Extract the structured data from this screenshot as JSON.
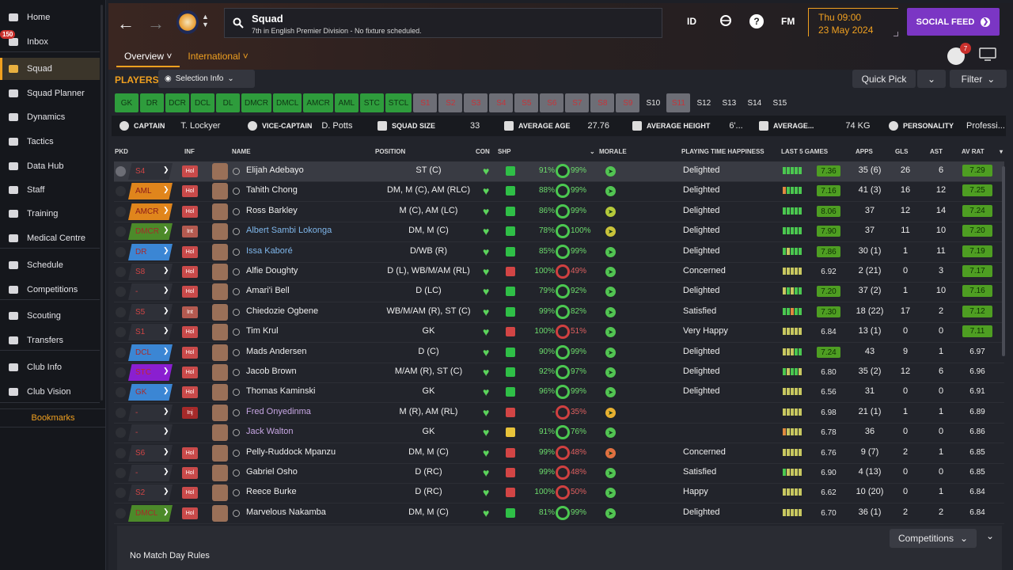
{
  "sidebar": {
    "inbox_badge": "150",
    "items": [
      {
        "label": "Home",
        "icon": "home-icon"
      },
      {
        "label": "Inbox",
        "icon": "inbox-icon"
      },
      {
        "label": "Squad",
        "icon": "squad-icon"
      },
      {
        "label": "Squad Planner",
        "icon": "planner-icon"
      },
      {
        "label": "Dynamics",
        "icon": "dynamics-icon"
      },
      {
        "label": "Tactics",
        "icon": "tactics-icon"
      },
      {
        "label": "Data Hub",
        "icon": "data-hub-icon"
      },
      {
        "label": "Staff",
        "icon": "staff-icon"
      },
      {
        "label": "Training",
        "icon": "training-icon"
      },
      {
        "label": "Medical Centre",
        "icon": "medical-icon"
      },
      {
        "label": "Schedule",
        "icon": "schedule-icon"
      },
      {
        "label": "Competitions",
        "icon": "trophy-icon"
      },
      {
        "label": "Scouting",
        "icon": "scouting-icon"
      },
      {
        "label": "Transfers",
        "icon": "transfers-icon"
      },
      {
        "label": "Club Info",
        "icon": "shield-icon"
      },
      {
        "label": "Club Vision",
        "icon": "vision-icon"
      }
    ],
    "bookmarks": "Bookmarks"
  },
  "header": {
    "title": "Squad",
    "subtitle": "7th in English Premier Division - No fixture scheduled.",
    "id_label": "ID",
    "fm_label": "FM",
    "help_label": "?",
    "day_time": "Thu 09:00",
    "date": "23 May 2024",
    "social_feed": "SOCIAL FEED",
    "people_badge": "7",
    "tabs": [
      {
        "label": "Overview ˅"
      },
      {
        "label": "International ˅"
      }
    ]
  },
  "toolbar": {
    "players_label": "PLAYERS",
    "selection_info": "Selection Info",
    "quick_pick": "Quick Pick",
    "filter": "Filter"
  },
  "positions": [
    {
      "label": "GK",
      "style": "green"
    },
    {
      "label": "DR",
      "style": "green"
    },
    {
      "label": "DCR",
      "style": "green"
    },
    {
      "label": "DCL",
      "style": "green"
    },
    {
      "label": "DL",
      "style": "green"
    },
    {
      "label": "DMCR",
      "style": "green"
    },
    {
      "label": "DMCL",
      "style": "green"
    },
    {
      "label": "AMCR",
      "style": "green"
    },
    {
      "label": "AML",
      "style": "green"
    },
    {
      "label": "STC",
      "style": "green"
    },
    {
      "label": "STCL",
      "style": "green"
    },
    {
      "label": "S1",
      "style": "grey"
    },
    {
      "label": "S2",
      "style": "grey"
    },
    {
      "label": "S3",
      "style": "grey"
    },
    {
      "label": "S4",
      "style": "grey"
    },
    {
      "label": "S5",
      "style": "grey"
    },
    {
      "label": "S6",
      "style": "grey"
    },
    {
      "label": "S7",
      "style": "grey"
    },
    {
      "label": "S8",
      "style": "grey"
    },
    {
      "label": "S9",
      "style": "grey"
    },
    {
      "label": "S10",
      "style": "plain"
    },
    {
      "label": "S11",
      "style": "grey"
    },
    {
      "label": "S12",
      "style": "plain"
    },
    {
      "label": "S13",
      "style": "plain"
    },
    {
      "label": "S14",
      "style": "plain"
    },
    {
      "label": "S15",
      "style": "plain"
    }
  ],
  "info_bar": {
    "captain_label": "CAPTAIN",
    "captain": "T. Lockyer",
    "vice_label": "VICE-CAPTAIN",
    "vice": "D. Potts",
    "size_label": "SQUAD SIZE",
    "size": "33",
    "age_label": "AVERAGE AGE",
    "age": "27.76",
    "height_label": "AVERAGE HEIGHT",
    "height": "6'...",
    "weight_label": "AVERAGE...",
    "weight": "74 KG",
    "personality_label": "PERSONALITY",
    "personality": "Professi..."
  },
  "columns": {
    "pkd": "PKD",
    "inf": "INF",
    "name": "NAME",
    "position": "POSITION",
    "con": "CON",
    "shp": "SHP",
    "morale": "MORALE",
    "pth": "PLAYING TIME HAPPINESS",
    "last5": "LAST 5 GAMES",
    "apps": "APPS",
    "gls": "GLS",
    "ast": "AST",
    "avrat": "AV RAT"
  },
  "players": [
    {
      "pos": "S4",
      "posColor": "#2e3038",
      "posText": "#d04545",
      "inf": "Hol",
      "name": "Elijah Adebayo",
      "nameStyle": "",
      "position": "ST (C)",
      "shp": "#2fbf47",
      "cond": "91%",
      "ringColor": "#4bc850",
      "morale": "99%",
      "moraleColor": "#6ddc6d",
      "moraleIcon": "#52c452",
      "pth": "Delighted",
      "bars": [
        "g",
        "g",
        "g",
        "g",
        "g"
      ],
      "last": "7.36",
      "lastHi": true,
      "apps": "35 (6)",
      "gls": "26",
      "ast": "6",
      "av": "7.29",
      "avHi": true,
      "pkd": true
    },
    {
      "pos": "AML",
      "posColor": "#e0851c",
      "posText": "#8a1a1a",
      "inf": "Hol",
      "name": "Tahith Chong",
      "nameStyle": "",
      "position": "DM, M (C), AM (RLC)",
      "shp": "#2fbf47",
      "cond": "88%",
      "ringColor": "#4bc850",
      "morale": "99%",
      "moraleColor": "#6ddc6d",
      "moraleIcon": "#52c452",
      "pth": "Delighted",
      "bars": [
        "o",
        "g",
        "g",
        "g",
        "g"
      ],
      "last": "7.16",
      "lastHi": true,
      "apps": "41 (3)",
      "gls": "16",
      "ast": "12",
      "av": "7.25",
      "avHi": true
    },
    {
      "pos": "AMCR",
      "posColor": "#e0851c",
      "posText": "#8a1a1a",
      "inf": "Hol",
      "name": "Ross Barkley",
      "nameStyle": "",
      "position": "M (C), AM (LC)",
      "shp": "#2fbf47",
      "cond": "86%",
      "ringColor": "#4bc850",
      "morale": "99%",
      "moraleColor": "#6ddc6d",
      "moraleIcon": "#b5c93a",
      "pth": "Delighted",
      "bars": [
        "g",
        "g",
        "g",
        "g",
        "g"
      ],
      "last": "8.06",
      "lastHi": true,
      "apps": "37",
      "gls": "12",
      "ast": "14",
      "av": "7.24",
      "avHi": true
    },
    {
      "pos": "DMCR",
      "posColor": "#4c8a2a",
      "posText": "#a82a2a",
      "inf": "Int",
      "name": "Albert Sambi Lokonga",
      "nameStyle": "blue",
      "position": "DM, M (C)",
      "shp": "#2fbf47",
      "cond": "78%",
      "ringColor": "#4bc850",
      "morale": "100%",
      "moraleColor": "#6ddc6d",
      "moraleIcon": "#c9c33a",
      "pth": "Delighted",
      "bars": [
        "g",
        "g",
        "g",
        "g",
        "g"
      ],
      "last": "7.90",
      "lastHi": true,
      "apps": "37",
      "gls": "11",
      "ast": "10",
      "av": "7.20",
      "avHi": true
    },
    {
      "pos": "DR",
      "posColor": "#3b86d4",
      "posText": "#a82a2a",
      "inf": "Hol",
      "name": "Issa Kaboré",
      "nameStyle": "blue",
      "position": "D/WB (R)",
      "shp": "#2fbf47",
      "cond": "85%",
      "ringColor": "#4bc850",
      "morale": "99%",
      "moraleColor": "#6ddc6d",
      "moraleIcon": "#52c452",
      "pth": "Delighted",
      "bars": [
        "g",
        "y",
        "g",
        "g",
        "g"
      ],
      "last": "7.86",
      "lastHi": true,
      "apps": "30 (1)",
      "gls": "1",
      "ast": "11",
      "av": "7.19",
      "avHi": true
    },
    {
      "pos": "S8",
      "posColor": "#2e3038",
      "posText": "#d04545",
      "inf": "Hol",
      "name": "Alfie Doughty",
      "nameStyle": "",
      "position": "D (L), WB/M/AM (RL)",
      "shp": "#d24545",
      "cond": "100%",
      "ringColor": "#d04040",
      "morale": "49%",
      "moraleColor": "#e06060",
      "moraleIcon": "#52c452",
      "pth": "Concerned",
      "bars": [
        "y",
        "y",
        "y",
        "y",
        "y"
      ],
      "last": "6.92",
      "lastHi": false,
      "apps": "2 (21)",
      "gls": "0",
      "ast": "3",
      "av": "7.17",
      "avHi": true
    },
    {
      "pos": "-",
      "posColor": "#2e3038",
      "posText": "#d04545",
      "inf": "Hol",
      "name": "Amari'i Bell",
      "nameStyle": "",
      "position": "D (LC)",
      "shp": "#2fbf47",
      "cond": "79%",
      "ringColor": "#4bc850",
      "morale": "92%",
      "moraleColor": "#6ddc6d",
      "moraleIcon": "#52c452",
      "pth": "Delighted",
      "bars": [
        "y",
        "g",
        "y",
        "g",
        "g"
      ],
      "last": "7.20",
      "lastHi": true,
      "apps": "37 (2)",
      "gls": "1",
      "ast": "10",
      "av": "7.16",
      "avHi": true
    },
    {
      "pos": "S5",
      "posColor": "#2e3038",
      "posText": "#d04545",
      "inf": "Int",
      "name": "Chiedozie Ogbene",
      "nameStyle": "",
      "position": "WB/M/AM (R), ST (C)",
      "shp": "#2fbf47",
      "cond": "99%",
      "ringColor": "#4bc850",
      "morale": "82%",
      "moraleColor": "#6ddc6d",
      "moraleIcon": "#52c452",
      "pth": "Satisfied",
      "bars": [
        "g",
        "g",
        "o",
        "g",
        "g"
      ],
      "last": "7.30",
      "lastHi": true,
      "apps": "18 (22)",
      "gls": "17",
      "ast": "2",
      "av": "7.12",
      "avHi": true
    },
    {
      "pos": "S1",
      "posColor": "#2e3038",
      "posText": "#d04545",
      "inf": "Hol",
      "name": "Tim Krul",
      "nameStyle": "",
      "position": "GK",
      "shp": "#d24545",
      "cond": "100%",
      "ringColor": "#d04040",
      "morale": "51%",
      "moraleColor": "#e06060",
      "moraleIcon": "#52c452",
      "pth": "Very Happy",
      "bars": [
        "y",
        "y",
        "y",
        "y",
        "y"
      ],
      "last": "6.84",
      "lastHi": false,
      "apps": "13 (1)",
      "gls": "0",
      "ast": "0",
      "av": "7.11",
      "avHi": true
    },
    {
      "pos": "DCL",
      "posColor": "#3b86d4",
      "posText": "#a82a2a",
      "inf": "Hol",
      "name": "Mads Andersen",
      "nameStyle": "",
      "position": "D (C)",
      "shp": "#2fbf47",
      "cond": "90%",
      "ringColor": "#4bc850",
      "morale": "99%",
      "moraleColor": "#6ddc6d",
      "moraleIcon": "#52c452",
      "pth": "Delighted",
      "bars": [
        "y",
        "y",
        "y",
        "g",
        "g"
      ],
      "last": "7.24",
      "lastHi": true,
      "apps": "43",
      "gls": "9",
      "ast": "1",
      "av": "6.97",
      "avHi": false
    },
    {
      "pos": "STC",
      "posColor": "#8a1fd0",
      "posText": "#c02a2a",
      "inf": "Hol",
      "name": "Jacob Brown",
      "nameStyle": "",
      "position": "M/AM (R), ST (C)",
      "shp": "#2fbf47",
      "cond": "92%",
      "ringColor": "#4bc850",
      "morale": "97%",
      "moraleColor": "#6ddc6d",
      "moraleIcon": "#52c452",
      "pth": "Delighted",
      "bars": [
        "g",
        "y",
        "g",
        "g",
        "y"
      ],
      "last": "6.80",
      "lastHi": false,
      "apps": "35 (2)",
      "gls": "12",
      "ast": "6",
      "av": "6.96",
      "avHi": false
    },
    {
      "pos": "GK",
      "posColor": "#3b86d4",
      "posText": "#a82a2a",
      "inf": "Hol",
      "name": "Thomas Kaminski",
      "nameStyle": "",
      "position": "GK",
      "shp": "#2fbf47",
      "cond": "96%",
      "ringColor": "#4bc850",
      "morale": "99%",
      "moraleColor": "#6ddc6d",
      "moraleIcon": "#52c452",
      "pth": "Delighted",
      "bars": [
        "y",
        "y",
        "y",
        "y",
        "y"
      ],
      "last": "6.56",
      "lastHi": false,
      "apps": "31",
      "gls": "0",
      "ast": "0",
      "av": "6.91",
      "avHi": false
    },
    {
      "pos": "-",
      "posColor": "#2e3038",
      "posText": "#d04545",
      "inf": "Inj",
      "name": "Fred Onyedinma",
      "nameStyle": "purple",
      "position": "M (R), AM (RL)",
      "shp": "#d24545",
      "cond": "-",
      "ringColor": "#d04040",
      "morale": "35%",
      "moraleColor": "#e06060",
      "moraleIcon": "#e8b030",
      "pth": "",
      "bars": [
        "y",
        "y",
        "y",
        "y",
        "y"
      ],
      "last": "6.98",
      "lastHi": false,
      "apps": "21 (1)",
      "gls": "1",
      "ast": "1",
      "av": "6.89",
      "avHi": false
    },
    {
      "pos": "-",
      "posColor": "#2e3038",
      "posText": "#d04545",
      "inf": "",
      "name": "Jack Walton",
      "nameStyle": "purple",
      "position": "GK",
      "shp": "#e8c33a",
      "cond": "91%",
      "ringColor": "#4bc850",
      "morale": "76%",
      "moraleColor": "#6ddc6d",
      "moraleIcon": "#52c452",
      "pth": "",
      "bars": [
        "o",
        "y",
        "y",
        "y",
        "y"
      ],
      "last": "6.78",
      "lastHi": false,
      "apps": "36",
      "gls": "0",
      "ast": "0",
      "av": "6.86",
      "avHi": false
    },
    {
      "pos": "S6",
      "posColor": "#2e3038",
      "posText": "#d04545",
      "inf": "Hol",
      "name": "Pelly-Ruddock Mpanzu",
      "nameStyle": "",
      "position": "DM, M (C)",
      "shp": "#d24545",
      "cond": "99%",
      "ringColor": "#d04040",
      "morale": "48%",
      "moraleColor": "#e06060",
      "moraleIcon": "#e07040",
      "pth": "Concerned",
      "bars": [
        "y",
        "y",
        "y",
        "y",
        "y"
      ],
      "last": "6.76",
      "lastHi": false,
      "apps": "9 (7)",
      "gls": "2",
      "ast": "1",
      "av": "6.85",
      "avHi": false
    },
    {
      "pos": "-",
      "posColor": "#2e3038",
      "posText": "#d04545",
      "inf": "Hol",
      "name": "Gabriel Osho",
      "nameStyle": "",
      "position": "D (RC)",
      "shp": "#d24545",
      "cond": "99%",
      "ringColor": "#d04040",
      "morale": "48%",
      "moraleColor": "#e06060",
      "moraleIcon": "#52c452",
      "pth": "Satisfied",
      "bars": [
        "g",
        "y",
        "y",
        "y",
        "y"
      ],
      "last": "6.90",
      "lastHi": false,
      "apps": "4 (13)",
      "gls": "0",
      "ast": "0",
      "av": "6.85",
      "avHi": false
    },
    {
      "pos": "S2",
      "posColor": "#2e3038",
      "posText": "#d04545",
      "inf": "Hol",
      "name": "Reece Burke",
      "nameStyle": "",
      "position": "D (RC)",
      "shp": "#d24545",
      "cond": "100%",
      "ringColor": "#d04040",
      "morale": "50%",
      "moraleColor": "#e06060",
      "moraleIcon": "#52c452",
      "pth": "Happy",
      "bars": [
        "y",
        "y",
        "y",
        "y",
        "y"
      ],
      "last": "6.62",
      "lastHi": false,
      "apps": "10 (20)",
      "gls": "0",
      "ast": "1",
      "av": "6.84",
      "avHi": false
    },
    {
      "pos": "DMCL",
      "posColor": "#4c8a2a",
      "posText": "#a82a2a",
      "inf": "Hol",
      "name": "Marvelous Nakamba",
      "nameStyle": "",
      "position": "DM, M (C)",
      "shp": "#2fbf47",
      "cond": "81%",
      "ringColor": "#4bc850",
      "morale": "99%",
      "moraleColor": "#6ddc6d",
      "moraleIcon": "#52c452",
      "pth": "Delighted",
      "bars": [
        "y",
        "y",
        "y",
        "y",
        "y"
      ],
      "last": "6.70",
      "lastHi": false,
      "apps": "36 (1)",
      "gls": "2",
      "ast": "2",
      "av": "6.84",
      "avHi": false
    }
  ],
  "footer": {
    "rules": "No Match Day Rules",
    "competitions": "Competitions"
  }
}
